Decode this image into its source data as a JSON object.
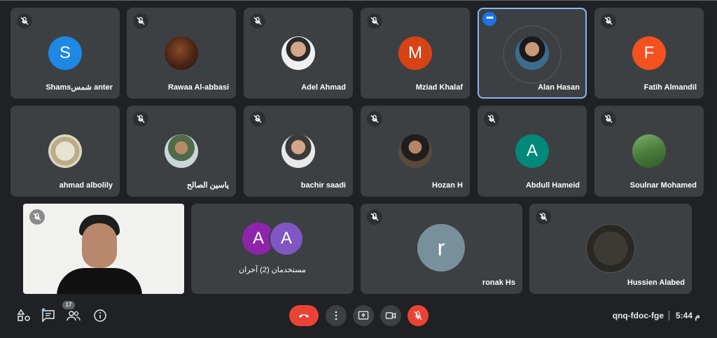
{
  "participants_row1": [
    {
      "name": "Shamsشمس anter",
      "initial": "S",
      "color": "#1e88e5",
      "muted": true
    },
    {
      "name": "Rawaa Al-abbasi",
      "photo": true,
      "muted": true
    },
    {
      "name": "Adel Ahmad",
      "photo": true,
      "muted": true
    },
    {
      "name": "Mziad Khalaf",
      "initial": "M",
      "color": "#d84315",
      "muted": true
    },
    {
      "name": "Alan Hasan",
      "photo": true,
      "active": true,
      "muted": false
    },
    {
      "name": "Fatih Almandil",
      "initial": "F",
      "color": "#f4511e",
      "muted": true
    }
  ],
  "participants_row2": [
    {
      "name": "ahmad albolily",
      "photo": true,
      "muted": false
    },
    {
      "name": "ياسين الصالح",
      "photo": true,
      "muted": true
    },
    {
      "name": "bachir saadi",
      "photo": true,
      "muted": true
    },
    {
      "name": "Hozan H",
      "photo": true,
      "muted": true
    },
    {
      "name": "Abdull Hameid",
      "initial": "A",
      "color": "#00897b",
      "muted": true
    },
    {
      "name": "Soulnar Mohamed",
      "photo": true,
      "muted": true
    }
  ],
  "participants_row3": [
    {
      "name": "",
      "self_view": true
    },
    {
      "name": "مستخدمان (2) آخران",
      "initials": [
        "A",
        "A"
      ],
      "colors": [
        "#8e24aa",
        "#7e57c2"
      ]
    },
    {
      "name": "ronak Hs",
      "initial": "r",
      "color": "#78909c",
      "muted": true
    },
    {
      "name": "Hussien Alabed",
      "photo": true,
      "muted": true
    }
  ],
  "bottom_bar": {
    "people_count": "17",
    "meeting_code": "qnq-fdoc-fge",
    "time": "5:44 م",
    "left_icons": [
      "activities-icon",
      "chat-icon",
      "people-icon",
      "info-icon"
    ],
    "center_icons": [
      "hang-up-icon",
      "more-options-icon",
      "present-screen-icon",
      "camera-icon",
      "mic-off-icon"
    ]
  },
  "colors": {
    "background": "#202124",
    "tile": "#3c4043",
    "accent": "#8ab4f8",
    "danger": "#ea4335"
  }
}
